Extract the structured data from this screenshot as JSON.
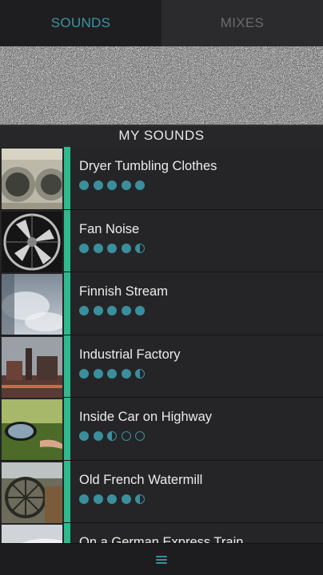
{
  "tabs": [
    {
      "label": "SOUNDS",
      "active": true
    },
    {
      "label": "MIXES",
      "active": false
    }
  ],
  "section_header": "MY SOUNDS",
  "accent_color": "#2dbb8e",
  "rating_color": "#3a8f9d",
  "sounds": [
    {
      "title": "Dryer Tumbling Clothes",
      "thumb": "laundry-dryer-image",
      "rating": [
        "full",
        "full",
        "full",
        "full",
        "full"
      ]
    },
    {
      "title": "Fan Noise",
      "thumb": "fan-image",
      "rating": [
        "full",
        "full",
        "full",
        "full",
        "half"
      ]
    },
    {
      "title": "Finnish Stream",
      "thumb": "stream-image",
      "rating": [
        "full",
        "full",
        "full",
        "full",
        "full"
      ]
    },
    {
      "title": "Industrial Factory",
      "thumb": "factory-image",
      "rating": [
        "full",
        "full",
        "full",
        "full",
        "half"
      ]
    },
    {
      "title": "Inside Car on Highway",
      "thumb": "car-mirror-image",
      "rating": [
        "full",
        "full",
        "half",
        "empty",
        "empty"
      ]
    },
    {
      "title": "Old French Watermill",
      "thumb": "watermill-image",
      "rating": [
        "full",
        "full",
        "full",
        "full",
        "half"
      ]
    },
    {
      "title": "On a German Express Train",
      "thumb": "train-image",
      "rating": []
    }
  ],
  "bottom_bar": {
    "icon": "menu-icon"
  }
}
